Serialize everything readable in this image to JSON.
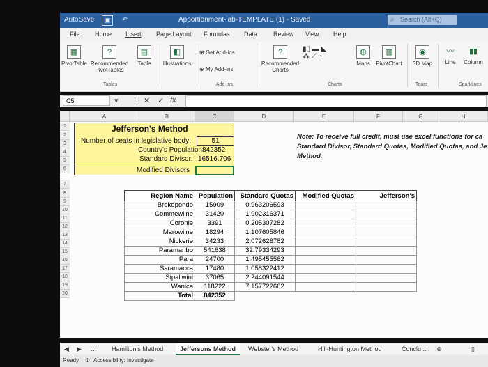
{
  "titlebar": {
    "autosave": "AutoSave",
    "document_title": "Apportionment-lab-TEMPLATE (1) - Saved",
    "search_placeholder": "Search (Alt+Q)"
  },
  "ribbon_tabs": [
    "File",
    "Home",
    "Insert",
    "Page Layout",
    "Formulas",
    "Data",
    "Review",
    "View",
    "Help"
  ],
  "active_tab": "Insert",
  "ribbon": {
    "pivot_table": "PivotTable",
    "recommended_pivot": "Recommended PivotTables",
    "table": "Table",
    "illustrations": "Illustrations",
    "get_addins": "Get Add-ins",
    "my_addins": "My Add-ins",
    "recommended_charts": "Recommended Charts",
    "maps": "Maps",
    "pivot_chart": "PivotChart",
    "map3d": "3D Map",
    "line": "Line",
    "column": "Column",
    "groups": {
      "tables": "Tables",
      "addins": "Add-ins",
      "charts": "Charts",
      "tours": "Tours",
      "sparklines": "Sparklines"
    }
  },
  "formula_bar": {
    "name_box": "C5",
    "cancel": "✕",
    "enter": "✓",
    "fx": "fx",
    "value": ""
  },
  "columns": [
    "A",
    "B",
    "C",
    "D",
    "E",
    "F",
    "G",
    "H"
  ],
  "rows": [
    "1",
    "2",
    "3",
    "4",
    "5",
    "6",
    "7",
    "8",
    "9",
    "10",
    "11",
    "12",
    "13",
    "14",
    "15",
    "16",
    "17",
    "18",
    "19",
    "20"
  ],
  "sheet": {
    "title": "Jefferson's Method",
    "seats_label": "Number of seats in legislative body:",
    "seats_value": "51",
    "population_label": "Country's Population:",
    "population_value": "842352",
    "divisor_label": "Standard Divisor:",
    "divisor_value": "16516.706",
    "modified_label": "Modified Divisors",
    "note_line1": "Note: To receive full credit, must use excel functions for ca",
    "note_line2": "Standard Divisor, Standard Quotas, Modified Quotas, and Je",
    "note_line3": "Method."
  },
  "table": {
    "headers": [
      "Region Name",
      "Population",
      "Standard Quotas",
      "Modified Quotas",
      "Jefferson's"
    ],
    "rows": [
      [
        "Brokopondo",
        "15909",
        "0.963206593"
      ],
      [
        "Commewijne",
        "31420",
        "1.902316371"
      ],
      [
        "Coronie",
        "3391",
        "0.205307282"
      ],
      [
        "Marowijne",
        "18294",
        "1.107605846"
      ],
      [
        "Nickerie",
        "34233",
        "2.072628782"
      ],
      [
        "Paramaribo",
        "541638",
        "32.79334293"
      ],
      [
        "Para",
        "24700",
        "1.495455582"
      ],
      [
        "Saramacca",
        "17480",
        "1.058322412"
      ],
      [
        "Sipaliwini",
        "37065",
        "2.244091544"
      ],
      [
        "Wanica",
        "118222",
        "7.157722662"
      ]
    ],
    "total_label": "Total",
    "total_value": "842352"
  },
  "sheet_tabs": [
    "Hamilton's Method",
    "Jeffersons Method",
    "Webster's Method",
    "Hill-Huntington Method",
    "Conclu ..."
  ],
  "active_sheet": "Jeffersons Method",
  "status": {
    "ready": "Ready",
    "accessibility": "Accessibility: Investigate"
  }
}
